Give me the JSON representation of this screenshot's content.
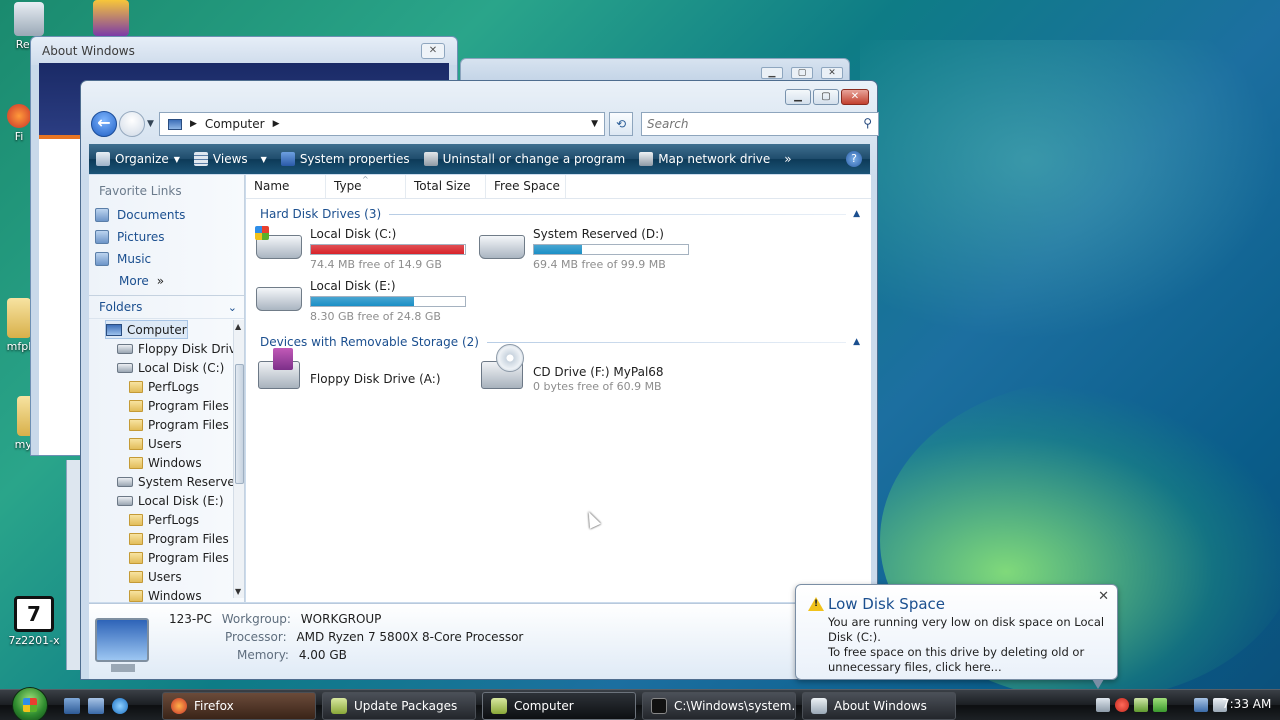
{
  "desktop": {
    "icons": [
      {
        "label": "Recy"
      },
      {
        "label": "Fi"
      },
      {
        "label": "mfpl"
      },
      {
        "label": "mypr"
      },
      {
        "label": "7z2201-x"
      }
    ]
  },
  "about_window": {
    "title": "About Windows"
  },
  "explorer": {
    "address": {
      "crumb": "Computer",
      "search_placeholder": "Search"
    },
    "toolbar": {
      "organize": "Organize",
      "views": "Views",
      "system_properties": "System properties",
      "uninstall": "Uninstall or change a program",
      "map_drive": "Map network drive",
      "more": "»"
    },
    "favorite_links": {
      "header": "Favorite Links",
      "items": [
        "Documents",
        "Pictures",
        "Music"
      ],
      "more": "More"
    },
    "folders": {
      "header": "Folders",
      "tree": [
        "Computer",
        "Floppy Disk Drive",
        "Local Disk (C:)",
        "PerfLogs",
        "Program Files",
        "Program Files (",
        "Users",
        "Windows",
        "System Reserved",
        "Local Disk (E:)",
        "PerfLogs",
        "Program Files",
        "Program Files (",
        "Users",
        "Windows"
      ]
    },
    "columns": [
      "Name",
      "Type",
      "Total Size",
      "Free Space"
    ],
    "groups": {
      "hdd": "Hard Disk Drives (3)",
      "removable": "Devices with Removable Storage (2)"
    },
    "drives": [
      {
        "name": "Local Disk (C:)",
        "free": "74.4 MB free of 14.9 GB",
        "used_fraction": 0.995,
        "bar_color": "#d8232a"
      },
      {
        "name": "System Reserved (D:)",
        "free": "69.4 MB free of 99.9 MB",
        "used_fraction": 0.31,
        "bar_color": "#1b8fc6"
      },
      {
        "name": "Local Disk (E:)",
        "free": "8.30 GB free of 24.8 GB",
        "used_fraction": 0.67,
        "bar_color": "#1b8fc6"
      }
    ],
    "removable": [
      {
        "name": "Floppy Disk Drive (A:)"
      },
      {
        "name": "CD Drive (F:) MyPal68",
        "free": "0 bytes free of 60.9 MB"
      }
    ],
    "details": {
      "pc_name": "123-PC",
      "workgroup_label": "Workgroup:",
      "workgroup": "WORKGROUP",
      "processor_label": "Processor:",
      "processor": "AMD Ryzen 7 5800X 8-Core Processor",
      "memory_label": "Memory:",
      "memory": "4.00 GB"
    }
  },
  "balloon": {
    "title": "Low Disk Space",
    "line1": "You are running very low on disk space on Local Disk (C:).",
    "line2": "To free space on this drive by deleting old or unnecessary files, click here..."
  },
  "taskbar": {
    "tasks": [
      "Firefox",
      "Update Packages",
      "Computer",
      "C:\\Windows\\system...",
      "About Windows"
    ],
    "clock": "7:33 AM"
  }
}
